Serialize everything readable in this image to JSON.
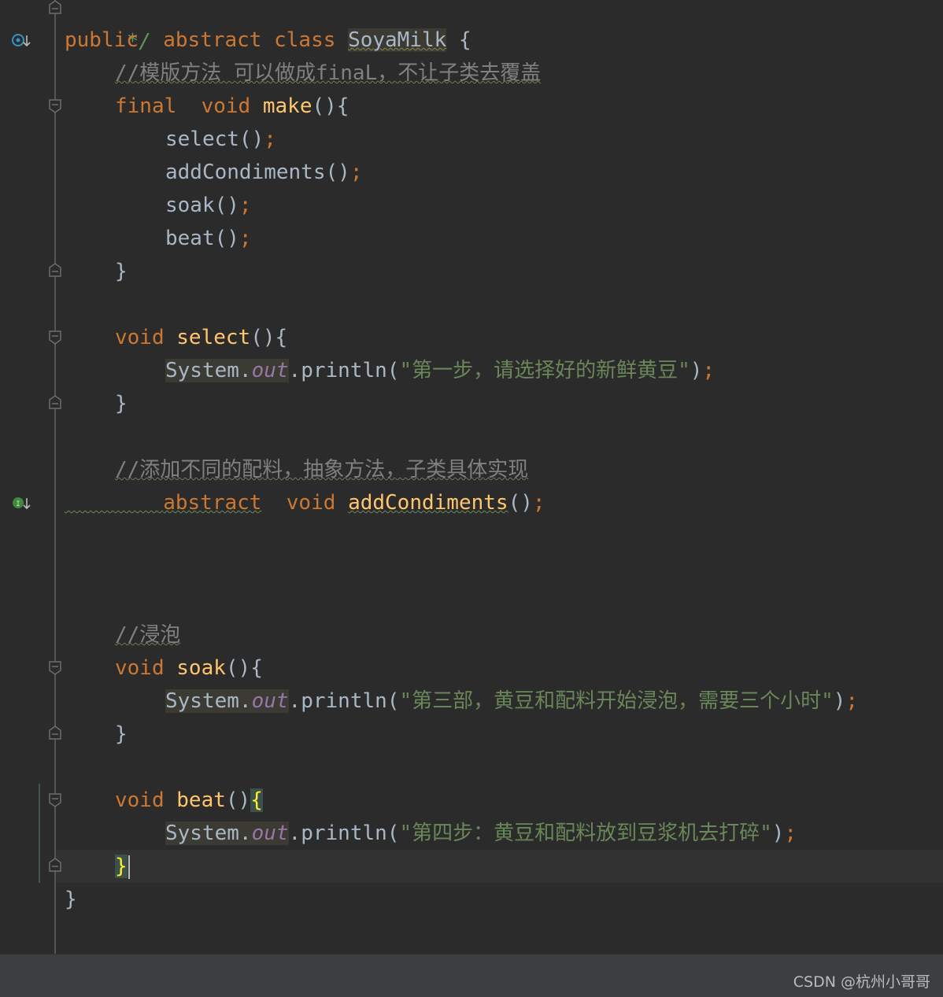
{
  "editor": {
    "lines": {
      "doc_end": "*/",
      "class_decl": {
        "kw_public": "public",
        "kw_abstract": "abstract",
        "kw_class": "class",
        "name": "SoyaMilk",
        "open": "{"
      },
      "comment_template": "//模版方法 可以做成finaL，不让子类去覆盖",
      "make_decl": {
        "kw_final": "final",
        "kw_void": "void",
        "name": "make",
        "parens": "(){"
      },
      "call_select": "select()",
      "call_add": "addCondiments()",
      "call_soak": "soak()",
      "call_beat": "beat()",
      "semi": ";",
      "close": "}",
      "select_decl": {
        "kw_void": "void",
        "name": "select",
        "parens": "(){"
      },
      "sys": "System",
      "dot": ".",
      "out": "out",
      "println": ".println(",
      "str_select": "\"第一步，请选择好的新鲜黄豆\"",
      "close_paren": ")",
      "comment_add": "//添加不同的配料，抽象方法，子类具体实现",
      "add_decl": {
        "kw_abstract": "abstract",
        "kw_void": "void",
        "name": "addCondiments",
        "parens": "()"
      },
      "comment_soak": "//浸泡",
      "soak_decl": {
        "kw_void": "void",
        "name": "soak",
        "parens": "(){"
      },
      "str_soak": "\"第三部，黄豆和配料开始浸泡，需要三个小时\"",
      "beat_decl": {
        "kw_void": "void",
        "name": "beat",
        "parens": "()",
        "brace": "{"
      },
      "str_beat": "\"第四步：黄豆和配料放到豆浆机去打碎\""
    }
  },
  "watermark": "CSDN @杭州小哥哥",
  "colors": {
    "background": "#2b2b2b",
    "keyword": "#cc7832",
    "function": "#ffc66d",
    "string": "#6a8759",
    "comment": "#808080",
    "field": "#9876aa",
    "text": "#a9b7c6"
  }
}
